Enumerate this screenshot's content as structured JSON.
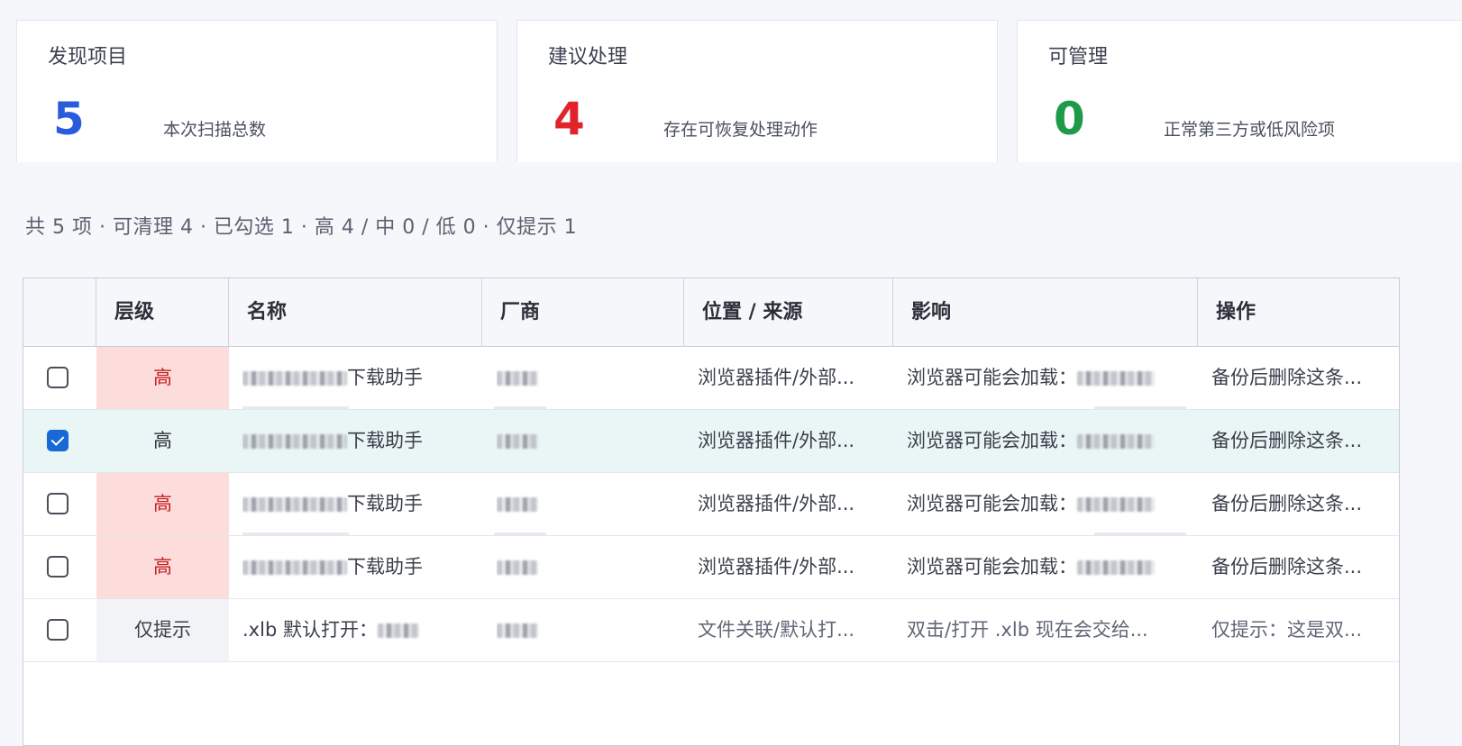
{
  "cards": [
    {
      "title": "发现项目",
      "number": "5",
      "desc": "本次扫描总数",
      "color": "#2a5bdc"
    },
    {
      "title": "建议处理",
      "number": "4",
      "desc": "存在可恢复处理动作",
      "color": "#e0242a"
    },
    {
      "title": "可管理",
      "number": "0",
      "desc": "正常第三方或低风险项",
      "color": "#1f9a4a"
    }
  ],
  "summary": "共 5 项 · 可清理 4 · 已勾选 1 · 高 4 / 中 0 / 低 0 · 仅提示 1",
  "table": {
    "headers": [
      "层级",
      "名称",
      "厂商",
      "位置 / 来源",
      "影响",
      "操作"
    ],
    "rows": [
      {
        "checked": false,
        "level": "高",
        "name_suffix": "下载助手",
        "location": "浏览器插件/外部...",
        "impact_prefix": "浏览器可能会加载：",
        "action": "备份后删除这条..."
      },
      {
        "checked": true,
        "level": "高",
        "name_suffix": "下载助手",
        "location": "浏览器插件/外部...",
        "impact_prefix": "浏览器可能会加载：",
        "action": "备份后删除这条..."
      },
      {
        "checked": false,
        "level": "高",
        "name_suffix": "下载助手",
        "location": "浏览器插件/外部...",
        "impact_prefix": "浏览器可能会加载：",
        "action": "备份后删除这条..."
      },
      {
        "checked": false,
        "level": "高",
        "name_suffix": "下载助手",
        "location": "浏览器插件/外部...",
        "impact_prefix": "浏览器可能会加载：",
        "action": "备份后删除这条..."
      },
      {
        "checked": false,
        "level": "仅提示",
        "name_suffix": ".xlb 默认打开：",
        "location": "文件关联/默认打...",
        "impact_prefix": "双击/打开 .xlb 现在会交给...",
        "action": "仅提示：这是双..."
      }
    ]
  },
  "colors": {
    "accent": "#1769d6",
    "high_bg": "#fddcdc",
    "high_text": "#c41e22",
    "selected_bg": "#eaf6f5"
  }
}
